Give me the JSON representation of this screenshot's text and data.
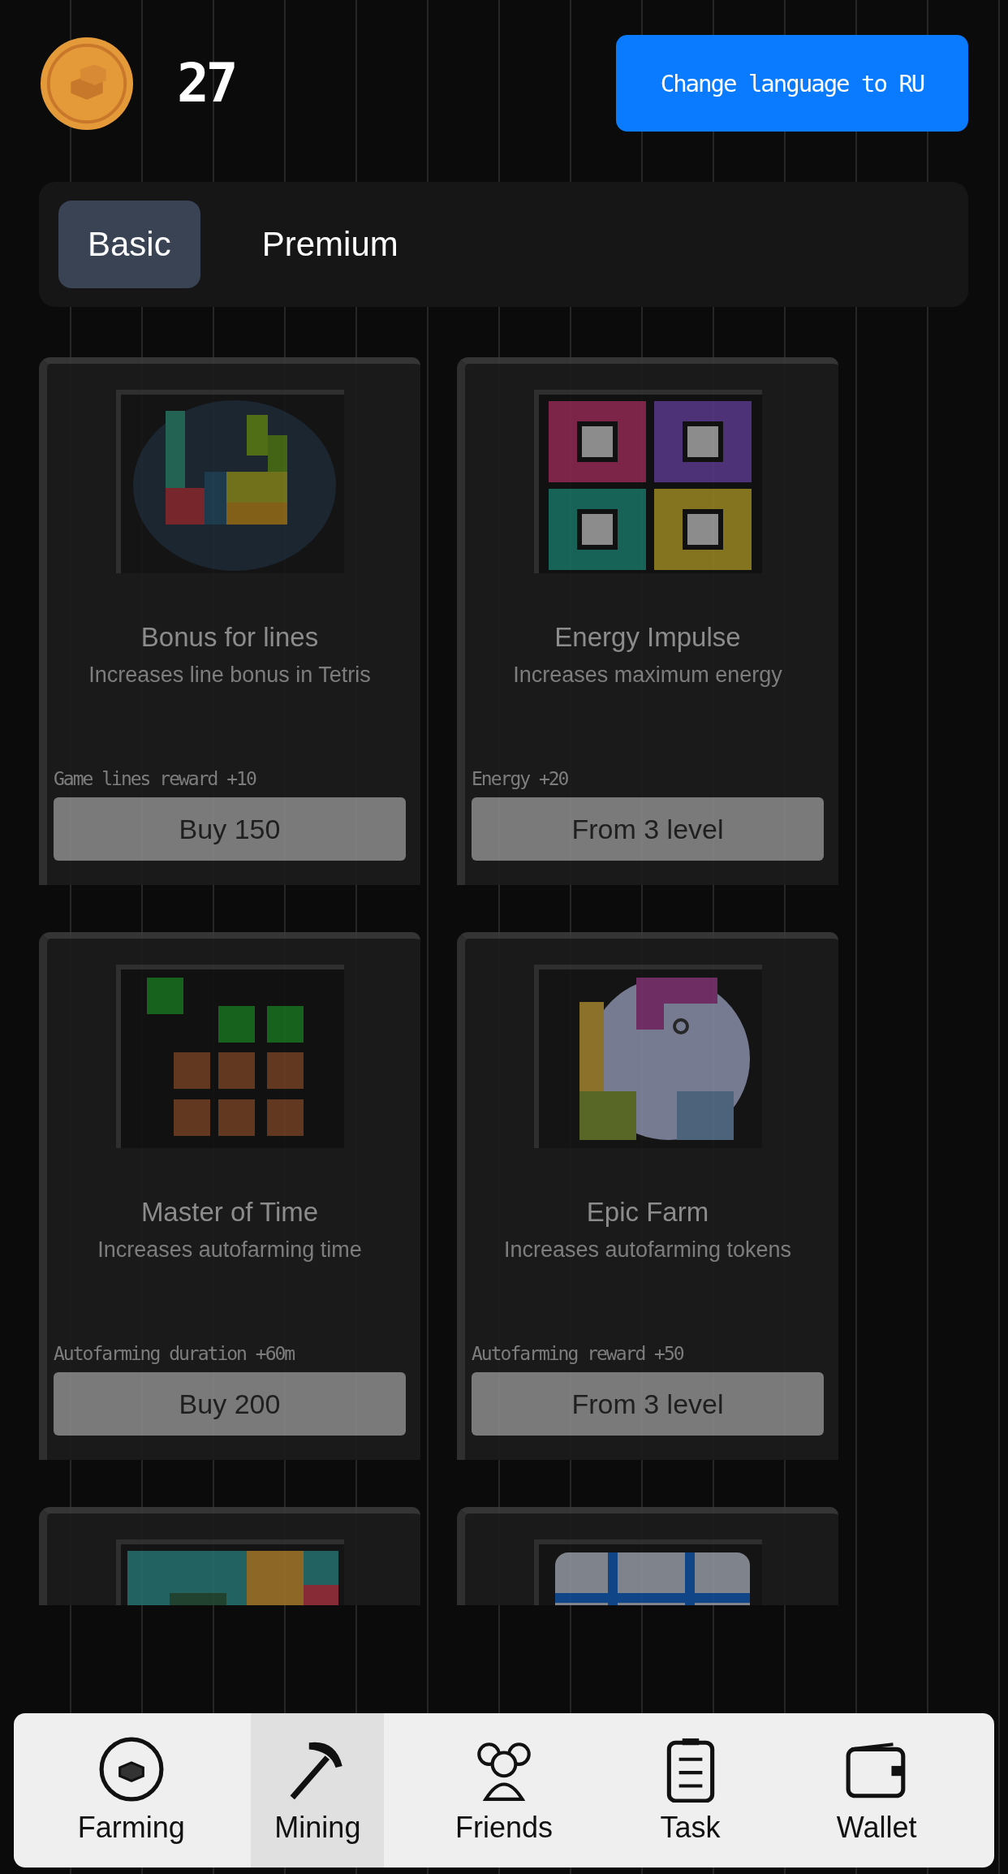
{
  "header": {
    "balance": "27",
    "language_button": "Change language to RU"
  },
  "tabs": [
    {
      "label": "Basic",
      "selected": true
    },
    {
      "label": "Premium",
      "selected": false
    }
  ],
  "cards": [
    {
      "title": "Bonus for lines",
      "description": "Increases line bonus in Tetris",
      "stat": "Game lines reward +10",
      "button": "Buy 150"
    },
    {
      "title": "Energy Impulse",
      "description": "Increases maximum energy",
      "stat": "Energy +20",
      "button": "From 3 level"
    },
    {
      "title": "Master of Time",
      "description": "Increases autofarming time",
      "stat": "Autofarming duration +60m",
      "button": "Buy 200"
    },
    {
      "title": "Epic Farm",
      "description": "Increases autofarming tokens",
      "stat": "Autofarming reward +50",
      "button": "From 3 level"
    }
  ],
  "nav": [
    {
      "label": "Farming",
      "selected": false
    },
    {
      "label": "Mining",
      "selected": true
    },
    {
      "label": "Friends",
      "selected": false
    },
    {
      "label": "Task",
      "selected": false
    },
    {
      "label": "Wallet",
      "selected": false
    }
  ]
}
